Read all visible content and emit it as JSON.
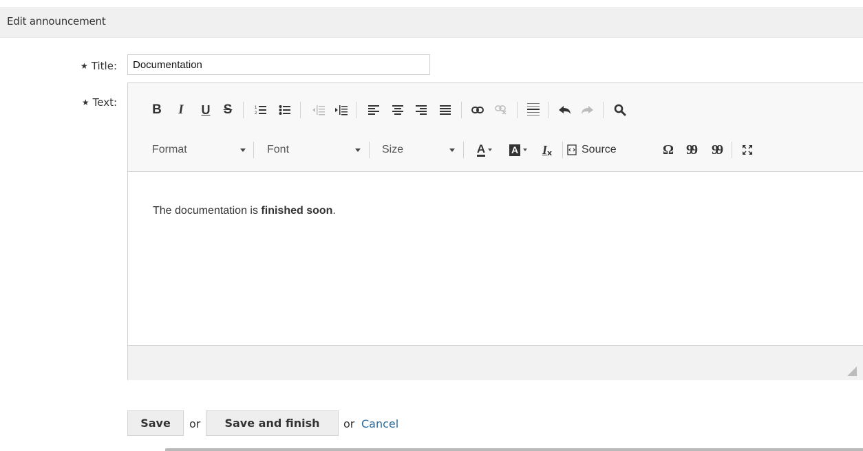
{
  "header": {
    "title": "Edit announcement"
  },
  "form": {
    "title_label": "Title:",
    "title_value": "Documentation",
    "text_label": "Text:",
    "required_marker": "★"
  },
  "toolbar": {
    "row1_icons": [
      "bold-icon",
      "italic-icon",
      "underline-icon",
      "strikethrough-icon",
      "numbered-list-icon",
      "bulleted-list-icon",
      "decrease-indent-icon",
      "increase-indent-icon",
      "align-left-icon",
      "align-center-icon",
      "align-right-icon",
      "justify-icon",
      "link-icon",
      "unlink-icon",
      "horizontal-line-icon",
      "undo-icon",
      "redo-icon",
      "find-icon"
    ],
    "format_label": "Format",
    "font_label": "Font",
    "size_label": "Size",
    "source_label": "Source",
    "bold_glyph": "B",
    "italic_glyph": "I",
    "underline_glyph": "U",
    "strike_glyph": "S",
    "text_color_glyph": "A",
    "bg_color_glyph": "A",
    "remove_format_glyph": "I",
    "special_char_glyph": "Ω",
    "blockquote_glyph": "99",
    "remove_blockquote_glyph": "99"
  },
  "editor": {
    "content_prefix": "The documentation is ",
    "content_bold": "finished soon",
    "content_suffix": "."
  },
  "actions": {
    "save_label": "Save",
    "or_1": "or",
    "save_finish_label": "Save and finish",
    "or_2": "or",
    "cancel_label": "Cancel"
  },
  "colors": {
    "header_bg": "#f0f0f0",
    "link": "#2d6a9a",
    "button_bg": "#eeeeee"
  }
}
